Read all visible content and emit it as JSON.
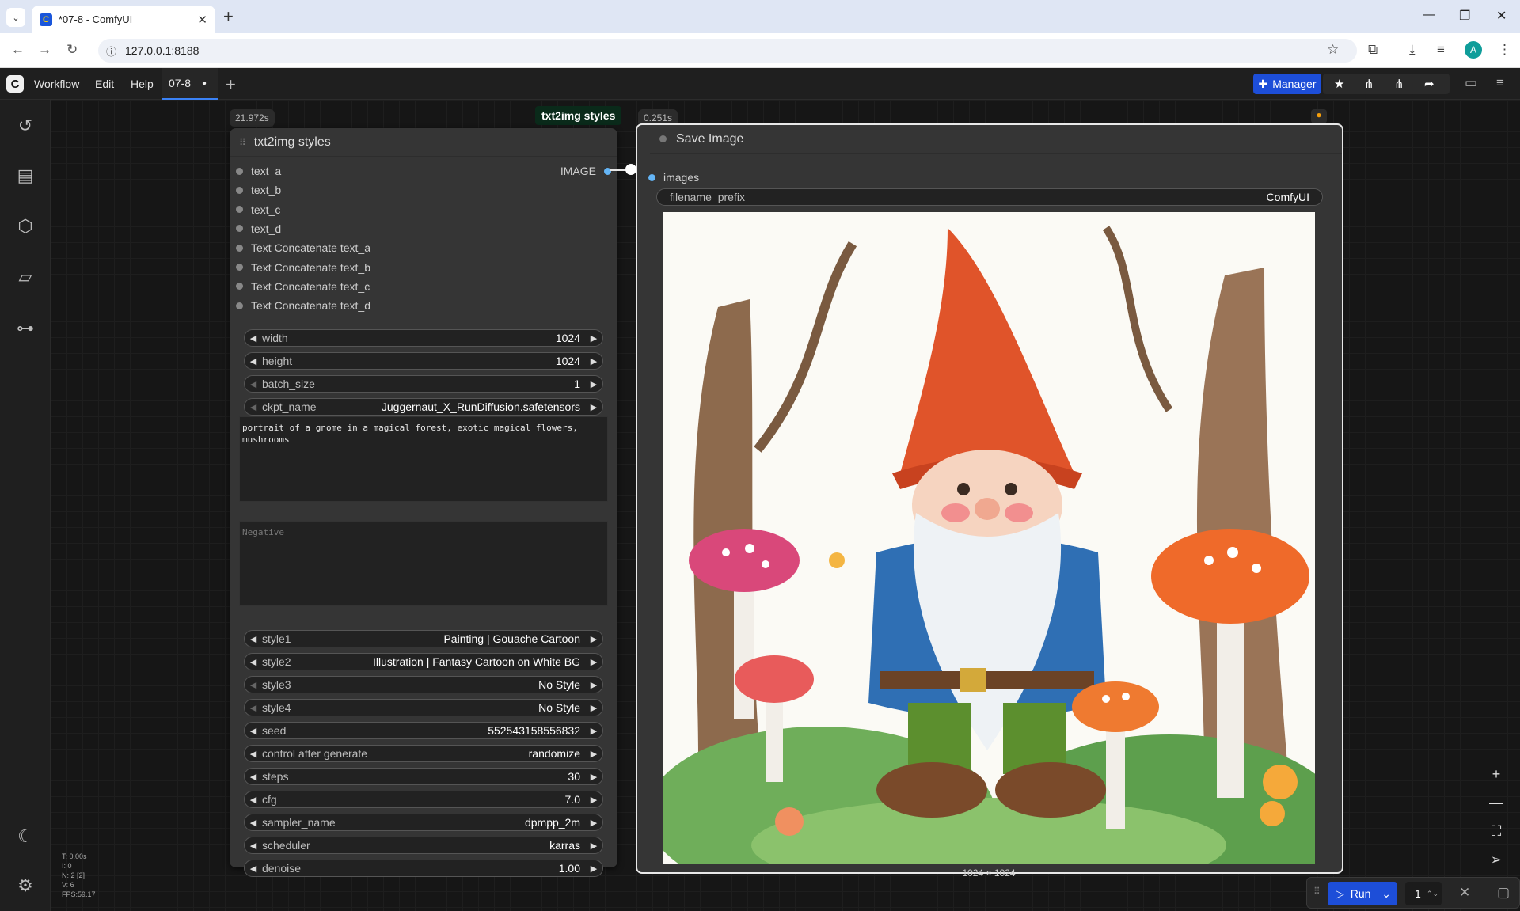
{
  "browser": {
    "tab_title": "*07-8 - ComfyUI",
    "favicon": "C",
    "url": "127.0.0.1:8188",
    "profile_initial": "A"
  },
  "menu": {
    "workflow": "Workflow",
    "edit": "Edit",
    "help": "Help",
    "tab": "07-8",
    "manager": "Manager"
  },
  "group_label": "txt2img styles",
  "txt2img": {
    "timing": "21.972s",
    "title": "txt2img styles",
    "output": "IMAGE",
    "inputs": [
      "text_a",
      "text_b",
      "text_c",
      "text_d",
      "Text Concatenate text_a",
      "Text Concatenate text_b",
      "Text Concatenate text_c",
      "Text Concatenate text_d"
    ],
    "widgets_top": [
      {
        "label": "width",
        "value": "1024"
      },
      {
        "label": "height",
        "value": "1024"
      },
      {
        "label": "batch_size",
        "value": "1"
      },
      {
        "label": "ckpt_name",
        "value": "Juggernaut_X_RunDiffusion.safetensors"
      }
    ],
    "positive_prompt": "portrait of a gnome in a magical forest, exotic magical flowers, mushrooms",
    "negative_placeholder": "Negative",
    "widgets_bottom": [
      {
        "label": "style1",
        "value": "Painting | Gouache Cartoon"
      },
      {
        "label": "style2",
        "value": "Illustration | Fantasy Cartoon on White BG"
      },
      {
        "label": "style3",
        "value": "No Style"
      },
      {
        "label": "style4",
        "value": "No Style"
      },
      {
        "label": "seed",
        "value": "552543158556832"
      },
      {
        "label": "control after generate",
        "value": "randomize"
      },
      {
        "label": "steps",
        "value": "30"
      },
      {
        "label": "cfg",
        "value": "7.0"
      },
      {
        "label": "sampler_name",
        "value": "dpmpp_2m"
      },
      {
        "label": "scheduler",
        "value": "karras"
      },
      {
        "label": "denoise",
        "value": "1.00"
      }
    ]
  },
  "save_image": {
    "timing": "0.251s",
    "title": "Save Image",
    "input": "images",
    "filename_label": "filename_prefix",
    "filename_value": "ComfyUI",
    "image_size": "1024 × 1024"
  },
  "run": {
    "label": "Run",
    "count": "1"
  },
  "stats": [
    "T: 0.00s",
    "I: 0",
    "N: 2 [2]",
    "V: 6",
    "FPS:59.17"
  ]
}
